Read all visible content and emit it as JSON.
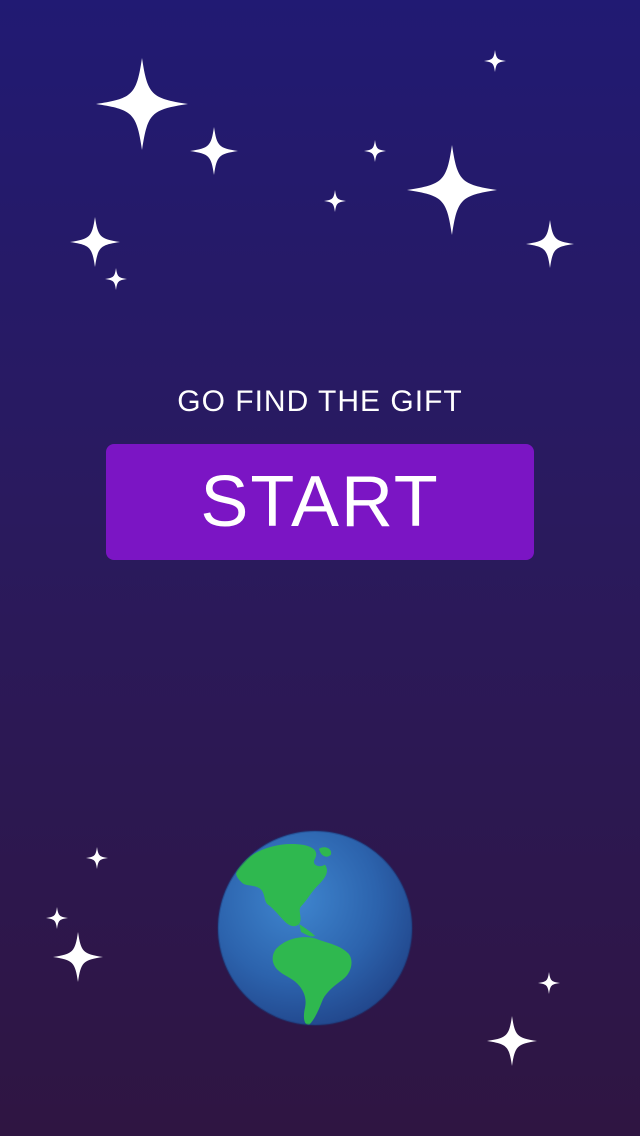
{
  "screen": {
    "tagline": "GO FIND THE GIFT",
    "start_label": "START"
  },
  "icons": {
    "star": "four-point-sparkle-icon",
    "planet": "earth-globe-icon"
  },
  "colors": {
    "background_top": "#211a73",
    "background_bottom": "#2f1542",
    "button": "#7b15c4",
    "text": "#ffffff",
    "ocean": "#2f6fb8",
    "land": "#2fb84f"
  }
}
